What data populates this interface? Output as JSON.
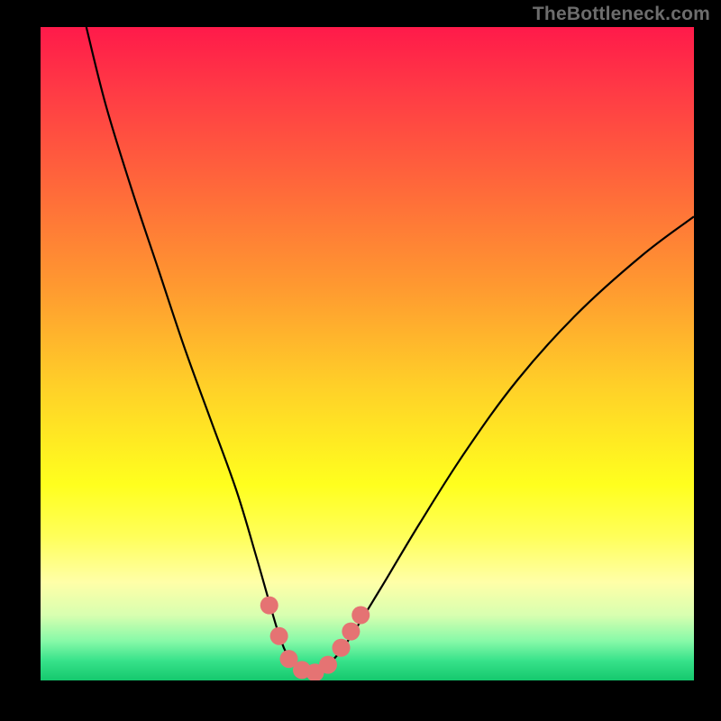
{
  "watermark": "TheBottleneck.com",
  "chart_data": {
    "type": "line",
    "title": "",
    "xlabel": "",
    "ylabel": "",
    "xlim": [
      0,
      100
    ],
    "ylim": [
      0,
      100
    ],
    "grid": false,
    "legend": false,
    "series": [
      {
        "name": "bottleneck-curve",
        "x": [
          7,
          10,
          14,
          18,
          22,
          26,
          30,
          33,
          35,
          36.5,
          38,
          40,
          42,
          44,
          47,
          52,
          58,
          65,
          73,
          82,
          92,
          100
        ],
        "values": [
          100,
          88,
          75,
          63,
          51,
          40,
          29,
          19,
          12,
          7,
          3.5,
          1.6,
          1.2,
          2.4,
          6,
          14,
          24,
          35,
          46,
          56,
          65,
          71
        ]
      }
    ],
    "markers": [
      {
        "name": "dot",
        "x": 35.0,
        "y": 11.5
      },
      {
        "name": "dot",
        "x": 36.5,
        "y": 6.8
      },
      {
        "name": "dot",
        "x": 38.0,
        "y": 3.3
      },
      {
        "name": "dot",
        "x": 40.0,
        "y": 1.6
      },
      {
        "name": "dot",
        "x": 42.0,
        "y": 1.2
      },
      {
        "name": "dot",
        "x": 44.0,
        "y": 2.4
      },
      {
        "name": "dot",
        "x": 46.0,
        "y": 5.0
      },
      {
        "name": "dot",
        "x": 47.5,
        "y": 7.5
      },
      {
        "name": "dot",
        "x": 49.0,
        "y": 10.0
      }
    ],
    "colors": {
      "curve": "#000000",
      "marker": "#e57373",
      "gradient_top": "#ff1a4a",
      "gradient_bottom": "#15c86d"
    }
  }
}
